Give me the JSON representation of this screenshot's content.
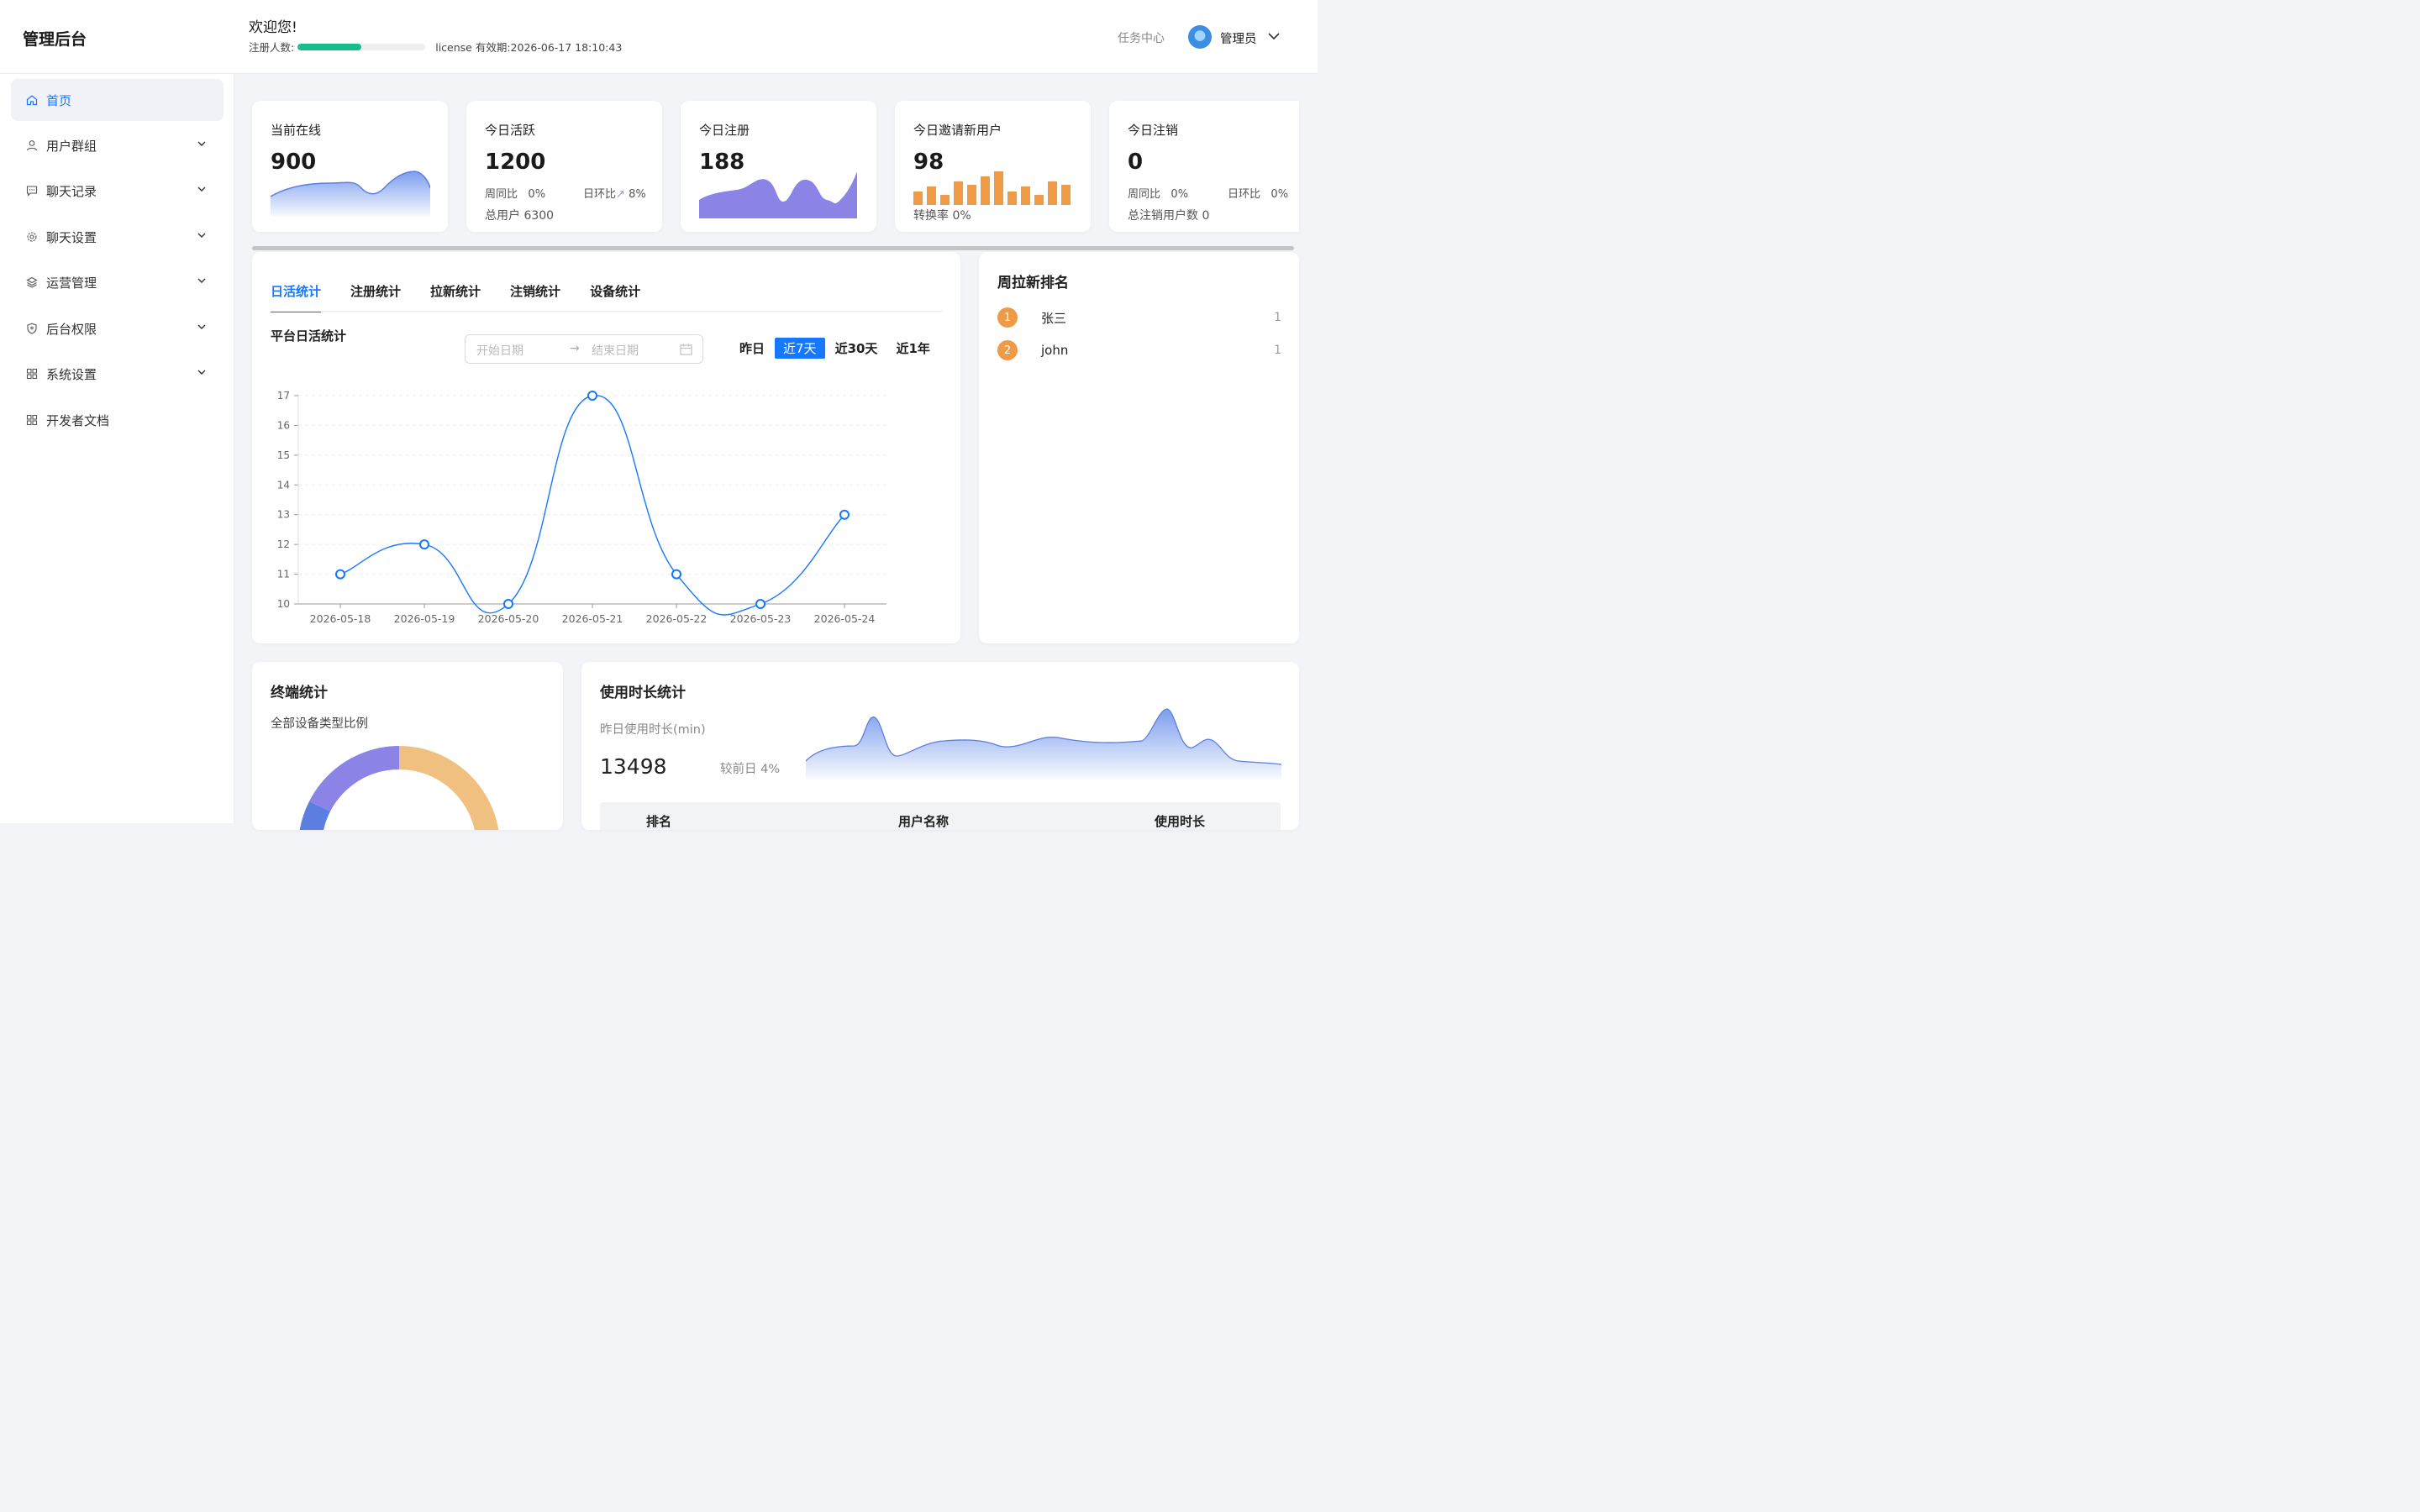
{
  "header": {
    "logo": "管理后台",
    "welcome": "欢迎您!",
    "reg_label": "注册人数:",
    "reg_progress": 0.5,
    "license": "license 有效期:2026-06-17 18:10:43",
    "task_center": "任务中心",
    "user_name": "管理员"
  },
  "sidebar": {
    "items": [
      {
        "label": "首页",
        "icon": "home-icon"
      },
      {
        "label": "用户群组",
        "icon": "user-icon"
      },
      {
        "label": "聊天记录",
        "icon": "message-icon"
      },
      {
        "label": "聊天设置",
        "icon": "gear-icon"
      },
      {
        "label": "运营管理",
        "icon": "layers-icon"
      },
      {
        "label": "后台权限",
        "icon": "shield-icon"
      },
      {
        "label": "系统设置",
        "icon": "apps-icon"
      },
      {
        "label": "开发者文档",
        "icon": "apps-icon"
      }
    ]
  },
  "stats": {
    "online": {
      "title": "当前在线",
      "value": "900"
    },
    "active": {
      "title": "今日活跃",
      "value": "1200",
      "week_label": "周同比",
      "week_value": "0%",
      "day_label": "日环比",
      "day_value": "8%",
      "total": "总用户 6300"
    },
    "register": {
      "title": "今日注册",
      "value": "188"
    },
    "invite": {
      "title": "今日邀请新用户",
      "value": "98",
      "conversion": "转换率 0%"
    },
    "cancel": {
      "title": "今日注销",
      "value": "0",
      "week_label": "周同比",
      "week_value": "0%",
      "day_label": "日环比",
      "day_value": "0%",
      "total": "总注销用户数 0"
    }
  },
  "main_chart": {
    "tabs": [
      "日活统计",
      "注册统计",
      "拉新统计",
      "注销统计",
      "设备统计"
    ],
    "title": "平台日活统计",
    "start_placeholder": "开始日期",
    "end_placeholder": "结束日期",
    "ranges": [
      "昨日",
      "近7天",
      "近30天",
      "近1年"
    ]
  },
  "chart_data": {
    "type": "line",
    "title": "平台日活统计",
    "x": [
      "2026-05-18",
      "2026-05-19",
      "2026-05-20",
      "2026-05-21",
      "2026-05-22",
      "2026-05-23",
      "2026-05-24"
    ],
    "values": [
      11,
      12,
      10,
      17,
      11,
      10,
      13
    ],
    "ylim": [
      10,
      17
    ],
    "yticks": [
      "10",
      "11",
      "12",
      "13",
      "14",
      "15",
      "16",
      "17"
    ],
    "grid": true,
    "color": "#1677ff"
  },
  "ranking": {
    "title": "周拉新排名",
    "rows": [
      {
        "rank": "1",
        "name": "张三",
        "score": "1"
      },
      {
        "rank": "2",
        "name": "john",
        "score": "1"
      }
    ]
  },
  "terminal": {
    "title": "终端统计",
    "subtitle": "全部设备类型比例"
  },
  "usage": {
    "title": "使用时长统计",
    "label": "昨日使用时长(min)",
    "value": "13498",
    "compare": "较前日 4%",
    "columns": [
      "排名",
      "用户名称",
      "使用时长"
    ]
  },
  "colors": {
    "accent": "#1677ff",
    "progress": "#18be8a",
    "purple": "#8b84e6",
    "orange": "#ef9a45",
    "light_blue": "#7d9eee"
  }
}
